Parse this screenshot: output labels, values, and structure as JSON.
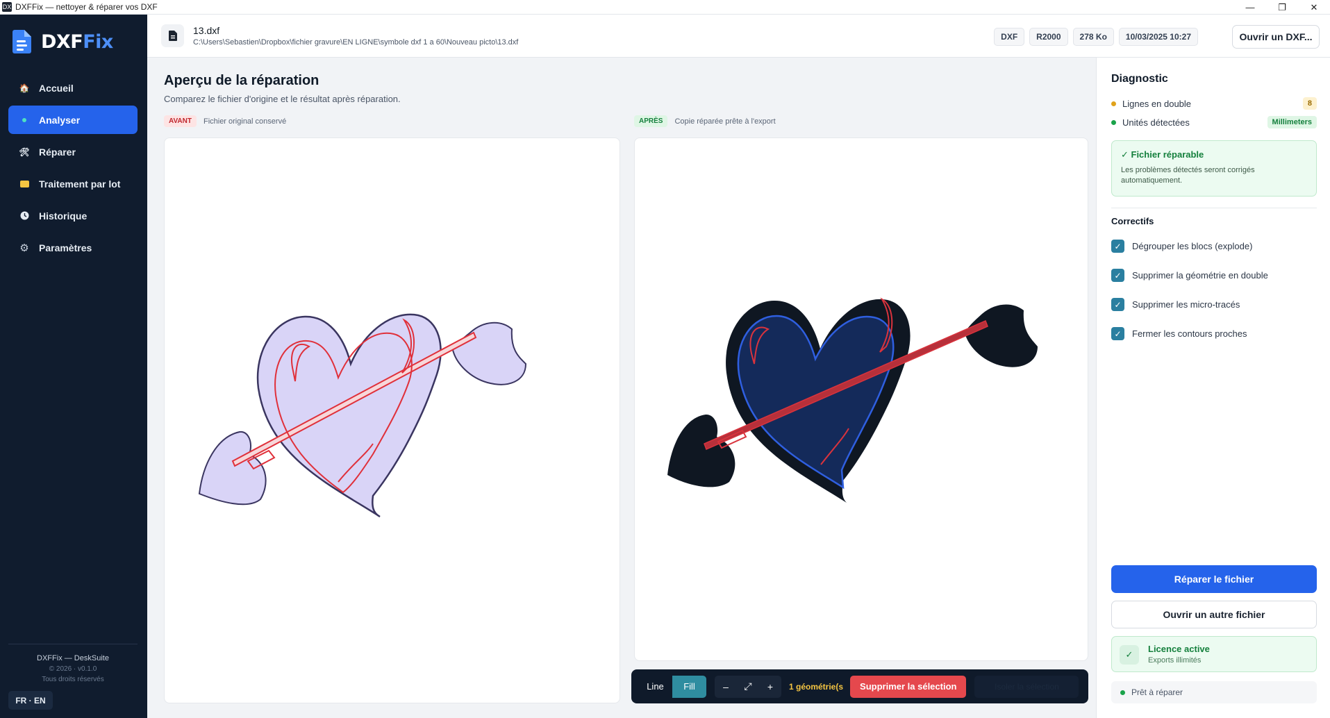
{
  "window": {
    "title": "DXFFix — nettoyer & réparer vos DXF",
    "app_icon": "DX",
    "controls": {
      "minimize": "—",
      "maximize": "❐",
      "close": "✕"
    }
  },
  "sidebar": {
    "logo": {
      "part1": "DXF",
      "part2": "Fix"
    },
    "items": [
      {
        "label": "Accueil",
        "icon": "home-icon",
        "glyph": "🏠",
        "active": false
      },
      {
        "label": "Analyser",
        "icon": "analyze-dot-icon",
        "glyph": "●",
        "active": true
      },
      {
        "label": "Réparer",
        "icon": "tools-icon",
        "glyph": "🛠",
        "active": false
      },
      {
        "label": "Traitement par lot",
        "icon": "folder-icon",
        "glyph": "📁",
        "active": false
      },
      {
        "label": "Historique",
        "icon": "clock-icon",
        "glyph": "🕘",
        "active": false
      },
      {
        "label": "Paramètres",
        "icon": "gear-icon",
        "glyph": "⚙",
        "active": false
      }
    ],
    "footer": {
      "name": "DXFFix — DeskSuite",
      "version": "© 2026 · v0.1.0",
      "rights": "Tous droits réservés"
    },
    "lang": "FR · EN"
  },
  "header": {
    "file_name": "13.dxf",
    "file_path": "C:\\Users\\Sebastien\\Dropbox\\fichier gravure\\EN LIGNE\\symbole dxf 1 a 60\\Nouveau picto\\13.dxf",
    "badges": [
      "DXF",
      "R2000",
      "278 Ko",
      "10/03/2025 10:27"
    ],
    "open_button": "Ouvrir un DXF..."
  },
  "main": {
    "title": "Aperçu de la réparation",
    "subtitle": "Comparez le fichier d'origine et le résultat après réparation.",
    "before": {
      "tag": "AVANT",
      "desc": "Fichier original conservé"
    },
    "after": {
      "tag": "APRÈS",
      "desc": "Copie réparée prête à l'export"
    }
  },
  "toolbar": {
    "line": "Line",
    "fill": "Fill",
    "zoom_out": "–",
    "fit": "⤢",
    "zoom_in": "+",
    "geometry_count": "1 géométrie(s",
    "delete_selection": "Supprimer la sélection",
    "hidden_action": "Isoler la sélection"
  },
  "diagnostic": {
    "title": "Diagnostic",
    "rows": [
      {
        "label": "Lignes en double",
        "value": "8",
        "color": "#e0a21a",
        "kind": "warn"
      },
      {
        "label": "Unités détectées",
        "value": "Millimeters",
        "color": "#1aa34a",
        "kind": "ok"
      }
    ],
    "status_card": {
      "title": "✓ Fichier réparable",
      "desc": "Les problèmes détectés seront corrigés automatiquement."
    },
    "fixes_title": "Correctifs",
    "fixes": [
      {
        "label": "Dégrouper les blocs (explode)",
        "checked": true
      },
      {
        "label": "Supprimer la géométrie en double",
        "checked": true
      },
      {
        "label": "Supprimer les micro-tracés",
        "checked": true
      },
      {
        "label": "Fermer les contours proches",
        "checked": true
      }
    ],
    "repair_button": "Réparer le fichier",
    "open_other_button": "Ouvrir un autre fichier",
    "license": {
      "icon": "✓",
      "title": "Licence active",
      "desc": "Exports illimités"
    },
    "status": "Prêt à réparer"
  },
  "colors": {
    "accent": "#2563eb",
    "sidebar_bg": "#101c2e",
    "before_fill": "#d9d4f7",
    "before_outline": "#3a3560",
    "before_red": "#e0303a",
    "after_dark": "#0f1722",
    "after_heart": "#142a5a",
    "after_blue": "#2f5fe0",
    "after_red": "#d9333d"
  }
}
